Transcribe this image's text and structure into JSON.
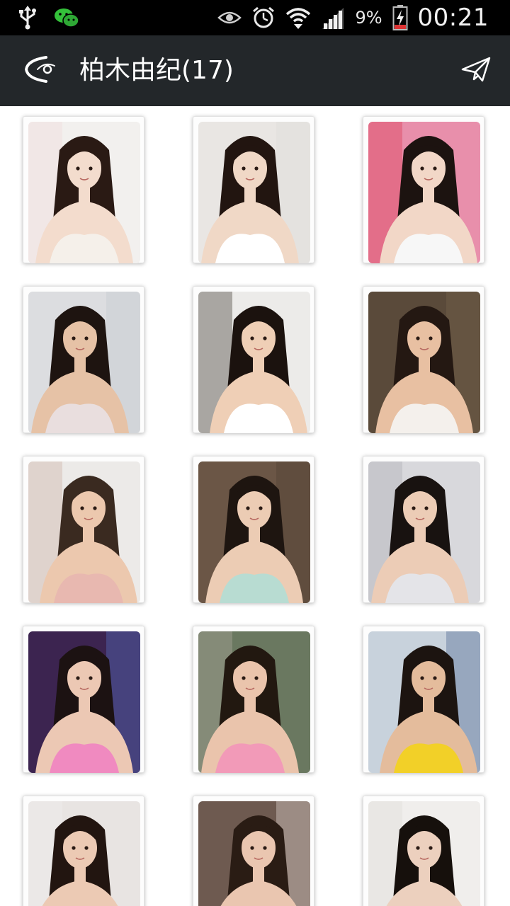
{
  "status_bar": {
    "left_icons": [
      "usb-icon",
      "wechat-icon"
    ],
    "right_icons": [
      "eye-icon",
      "alarm-clock-icon",
      "wifi-icon",
      "signal-icon"
    ],
    "battery_percent": "9%",
    "battery_icon": "battery-charging-icon",
    "time": "00:21"
  },
  "action_bar": {
    "back_icon": "back-arrow-icon",
    "title": "柏木由纪(17)",
    "share_icon": "send-icon"
  },
  "gallery": {
    "columns": 3,
    "photos": [
      {
        "background": "#f2f0ee",
        "skin": "#f3dccd",
        "hair": "#2a1a14",
        "clothing": "#f5f0ea",
        "accent": "#f2d6d6"
      },
      {
        "background": "#e9e6e3",
        "skin": "#f0d8c6",
        "hair": "#221510",
        "clothing": "#ffffff",
        "accent": "#dedad6"
      },
      {
        "background": "#e88fab",
        "skin": "#f2d7c7",
        "hair": "#1c1310",
        "clothing": "#f7f7f7",
        "accent": "#d9324a"
      },
      {
        "background": "#dcdde0",
        "skin": "#e6c2a6",
        "hair": "#1e1410",
        "clothing": "#e9dede",
        "accent": "#c0c5cb"
      },
      {
        "background": "#ecebe9",
        "skin": "#efcfb6",
        "hair": "#1b120e",
        "clothing": "#ffffff",
        "accent": "#2d2420"
      },
      {
        "background": "#5a4a3a",
        "skin": "#e8c0a2",
        "hair": "#241812",
        "clothing": "#f4f0ec",
        "accent": "#7b6650"
      },
      {
        "background": "#eceae8",
        "skin": "#ecc8ae",
        "hair": "#3a2a20",
        "clothing": "#e8b8b0",
        "accent": "#c8a89c"
      },
      {
        "background": "#6b5646",
        "skin": "#ecccb4",
        "hair": "#1e1510",
        "clothing": "#b8dcd2",
        "accent": "#4d3c30"
      },
      {
        "background": "#d8d8dc",
        "skin": "#ecccb6",
        "hair": "#181210",
        "clothing": "#e4e4e8",
        "accent": "#a8a8b0"
      },
      {
        "background": "#3c2450",
        "skin": "#ecc8b4",
        "hair": "#1c1212",
        "clothing": "#f08ac0",
        "accent": "#5a7ad0"
      },
      {
        "background": "#6a7860",
        "skin": "#eac4ac",
        "hair": "#221810",
        "clothing": "#f29ab8",
        "accent": "#b8b0a6"
      },
      {
        "background": "#c8d2dc",
        "skin": "#e4bc9c",
        "hair": "#1c1410",
        "clothing": "#f2d028",
        "accent": "#3c5a86"
      },
      {
        "background": "#e8e4e2",
        "skin": "#eccab4",
        "hair": "#221510",
        "clothing": "#e03a3a",
        "accent": "#f0f0f0"
      },
      {
        "background": "#6e5a50",
        "skin": "#eac6b0",
        "hair": "#2a1c14",
        "clothing": "#e83a40",
        "accent": "#f4ece6"
      },
      {
        "background": "#f0eeec",
        "skin": "#ecd0be",
        "hair": "#16100c",
        "clothing": "#ffffff",
        "accent": "#dcdad6"
      }
    ]
  }
}
